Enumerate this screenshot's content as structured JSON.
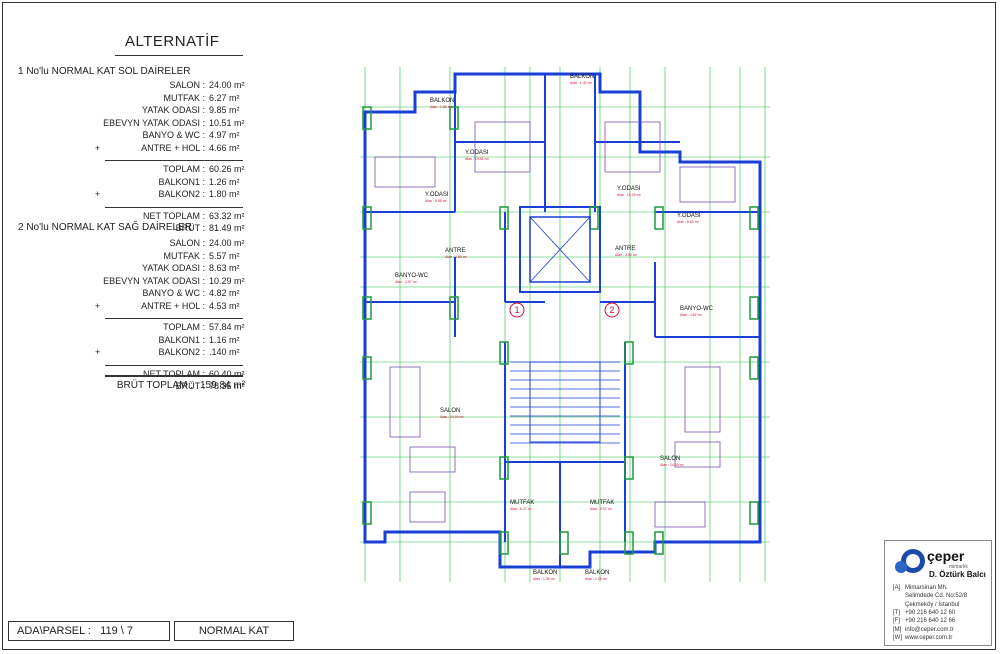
{
  "title": "ALTERNATİF",
  "section1": {
    "heading": "1  No'lu NORMAL KAT SOL DAİRELER",
    "rooms": [
      {
        "label": "SALON :",
        "value": "24.00 m²",
        "plus": ""
      },
      {
        "label": "MUTFAK :",
        "value": "6.27 m²",
        "plus": ""
      },
      {
        "label": "YATAK ODASI :",
        "value": "9.85 m²",
        "plus": ""
      },
      {
        "label": "EBEVYN YATAK ODASI :",
        "value": "10.51 m²",
        "plus": ""
      },
      {
        "label": "BANYO & WC :",
        "value": "4.97 m²",
        "plus": ""
      },
      {
        "label": "ANTRE + HOL :",
        "value": "4.66 m²",
        "plus": "+"
      }
    ],
    "totals": [
      {
        "label": "TOPLAM :",
        "value": "60.26 m²",
        "plus": ""
      },
      {
        "label": "BALKON1 :",
        "value": "1.26 m²",
        "plus": ""
      },
      {
        "label": "BALKON2 :",
        "value": "1.80 m²",
        "plus": "+"
      }
    ],
    "net": [
      {
        "label": "NET TOPLAM :",
        "value": "63.32 m²"
      },
      {
        "label": "BRÜT :",
        "value": "81.49 m²"
      }
    ]
  },
  "section2": {
    "heading": "2  No'lu NORMAL KAT SAĞ DAİRELER",
    "rooms": [
      {
        "label": "SALON :",
        "value": "24.00 m²",
        "plus": ""
      },
      {
        "label": "MUTFAK :",
        "value": "5.57 m²",
        "plus": ""
      },
      {
        "label": "YATAK ODASI :",
        "value": "8.63 m²",
        "plus": ""
      },
      {
        "label": "EBEVYN YATAK ODASI :",
        "value": "10.29 m²",
        "plus": ""
      },
      {
        "label": "BANYO & WC :",
        "value": "4.82 m²",
        "plus": ""
      },
      {
        "label": "ANTRE + HOL :",
        "value": "4.53 m²",
        "plus": "+"
      }
    ],
    "totals": [
      {
        "label": "TOPLAM :",
        "value": "57.84 m²",
        "plus": ""
      },
      {
        "label": "BALKON1 :",
        "value": "1.16 m²",
        "plus": ""
      },
      {
        "label": "BALKON2 :",
        "value": ".140 m²",
        "plus": "+"
      }
    ],
    "net": [
      {
        "label": "NET TOPLAM :",
        "value": "60.40 m²"
      },
      {
        "label": "BRÜT :",
        "value": "78.35 m²"
      }
    ]
  },
  "brut_total": {
    "label": "BRÜT TOPLAM :",
    "value": "159.84 m²"
  },
  "footer": {
    "parcel_label": "ADA\\PARSEL :",
    "parcel_value": "119 \\ 7",
    "floor": "NORMAL KAT"
  },
  "logo": {
    "brand": "çeper",
    "sub": "mimarlık",
    "name": "D. Öztürk Balcı",
    "lines": [
      {
        "tag": "[A]",
        "text": "Mimarsinan Mh."
      },
      {
        "tag": "",
        "text": "Selimdede Cd. No:52/8"
      },
      {
        "tag": "",
        "text": "Çekmeköy / İstanbul"
      },
      {
        "tag": "[T]",
        "text": "+90 216 640 12 60"
      },
      {
        "tag": "[F]",
        "text": "+90 216 640 12 66"
      },
      {
        "tag": "[M]",
        "text": "info@ceper.com.tr"
      },
      {
        "tag": "[W]",
        "text": "www.ceper.com.tr"
      }
    ]
  },
  "plan": {
    "rooms": [
      {
        "name": "BALKON",
        "area": "Alan : 1.66 m²"
      },
      {
        "name": "BALKON",
        "area": "Alan : 1.40 m²"
      },
      {
        "name": "Y.ODASI",
        "area": "Alan : 10.51 m²"
      },
      {
        "name": "Y.ODASI",
        "area": "Alan : 10.29 m²"
      },
      {
        "name": "Y.ODASI",
        "area": "Alan : 9.85 m²"
      },
      {
        "name": "Y.ODASI",
        "area": "Alan : 8.63 m²"
      },
      {
        "name": "ANTRE",
        "area": "Alan : 4.66 m²"
      },
      {
        "name": "ANTRE",
        "area": "Alan : 4.53 m²"
      },
      {
        "name": "BANYO-WC",
        "area": "Alan : 4.97 m²"
      },
      {
        "name": "BANYO-WC",
        "area": "Alan : 4.82 m²"
      },
      {
        "name": "SALON",
        "area": "Alan : 24.00 m²"
      },
      {
        "name": "SALON",
        "area": "Alan : 24.00 m²"
      },
      {
        "name": "MUTFAK",
        "area": "Alan : 6.27 m²"
      },
      {
        "name": "MUTFAK",
        "area": "Alan : 5.57 m²"
      },
      {
        "name": "BALKON",
        "area": "Alan : 1.26 m²"
      },
      {
        "name": "BALKON",
        "area": "Alan : 1.16 m²"
      }
    ],
    "unit_markers": [
      "1",
      "2"
    ],
    "colors": {
      "wall": "#1a3fd6",
      "column": "#1f9a3a",
      "grid": "#22c040",
      "annot": "#d01030",
      "furniture": "#7a4fb0"
    }
  }
}
